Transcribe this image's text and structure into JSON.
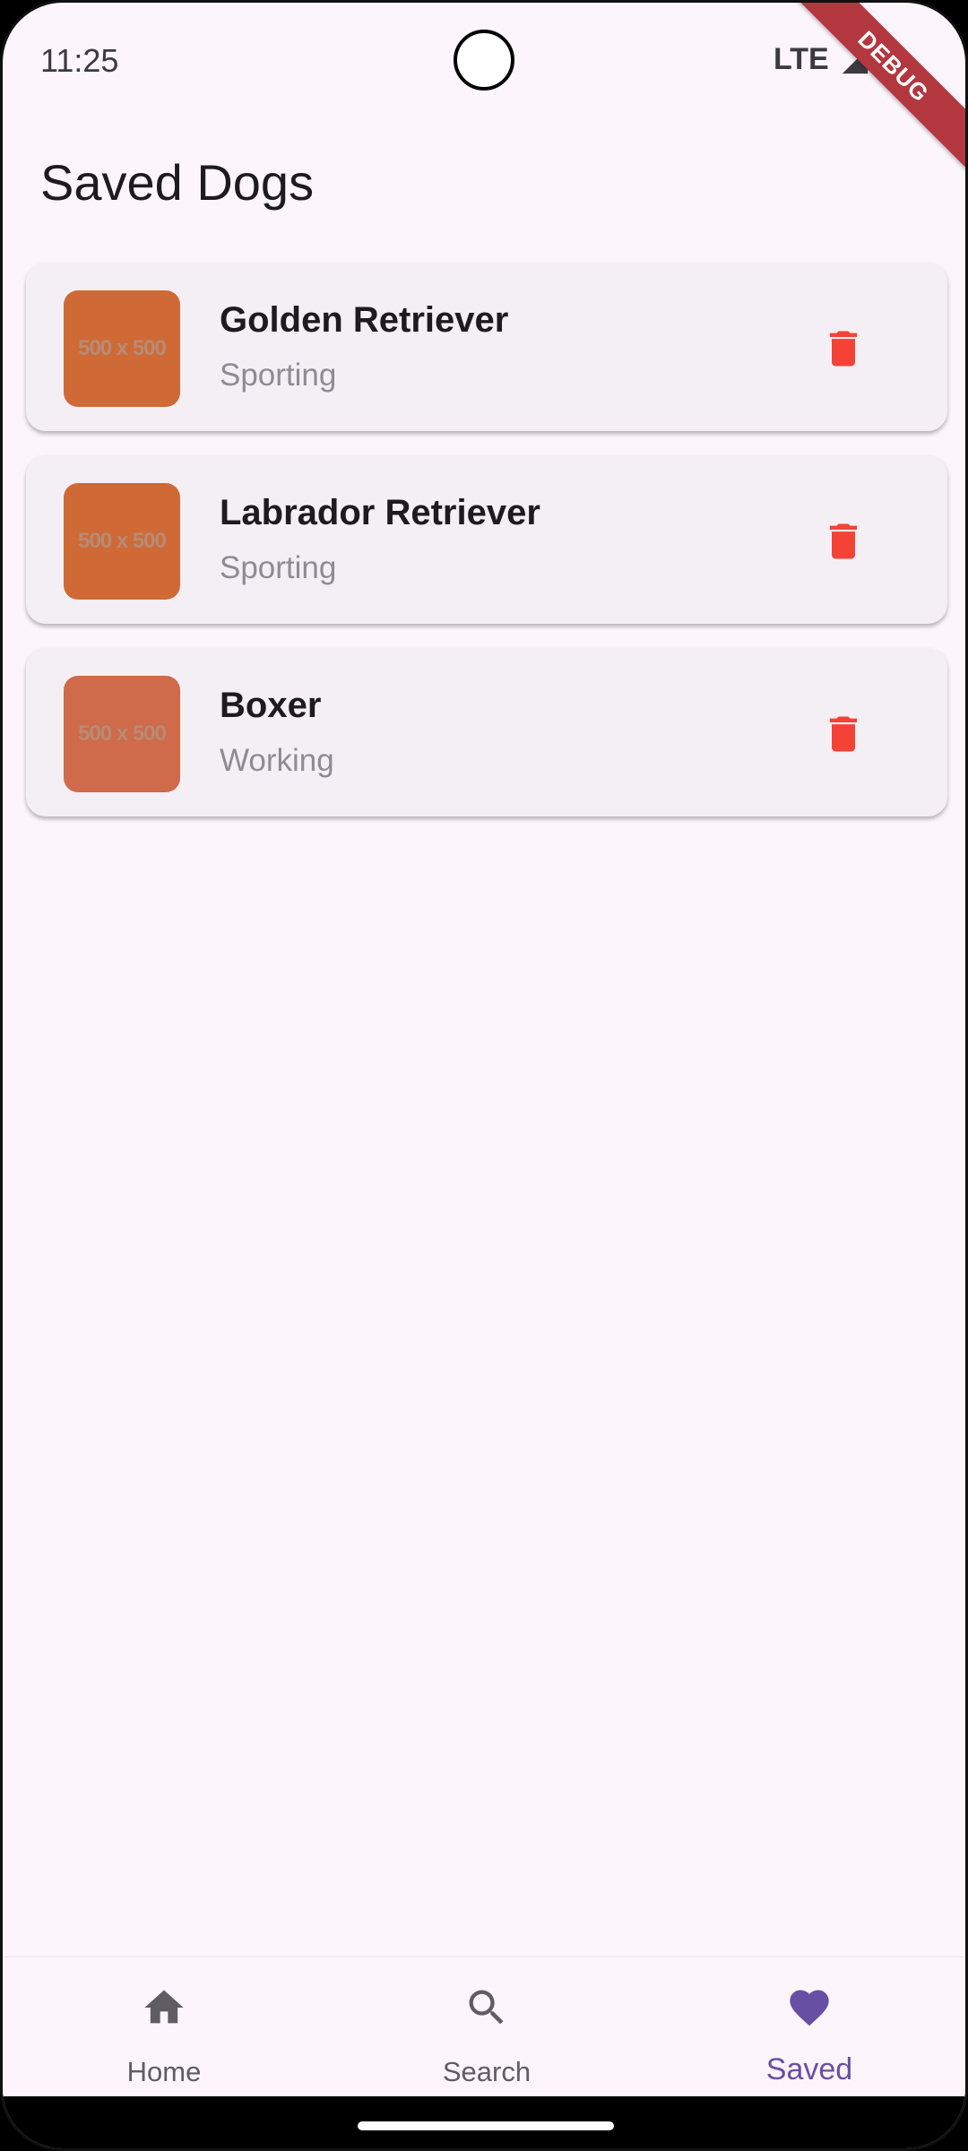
{
  "status_bar": {
    "time": "11:25",
    "network": "LTE",
    "debug_banner": "DEBUG"
  },
  "page": {
    "title": "Saved Dogs"
  },
  "dogs": [
    {
      "name": "Golden Retriever",
      "group": "Sporting",
      "image_placeholder": "500 x 500"
    },
    {
      "name": "Labrador Retriever",
      "group": "Sporting",
      "image_placeholder": "500 x 500"
    },
    {
      "name": "Boxer",
      "group": "Working",
      "image_placeholder": "500 x 500"
    }
  ],
  "icons": {
    "delete": "trash-icon",
    "home": "home-icon",
    "search": "search-icon",
    "saved": "heart-icon"
  },
  "colors": {
    "background": "#fcf5fc",
    "card": "#f4eff4",
    "delete": "#f44336",
    "accent": "#6750a4",
    "thumbnail": "#cf6a36"
  },
  "bottom_nav": {
    "items": [
      {
        "label": "Home",
        "active": false
      },
      {
        "label": "Search",
        "active": false
      },
      {
        "label": "Saved",
        "active": true
      }
    ]
  }
}
